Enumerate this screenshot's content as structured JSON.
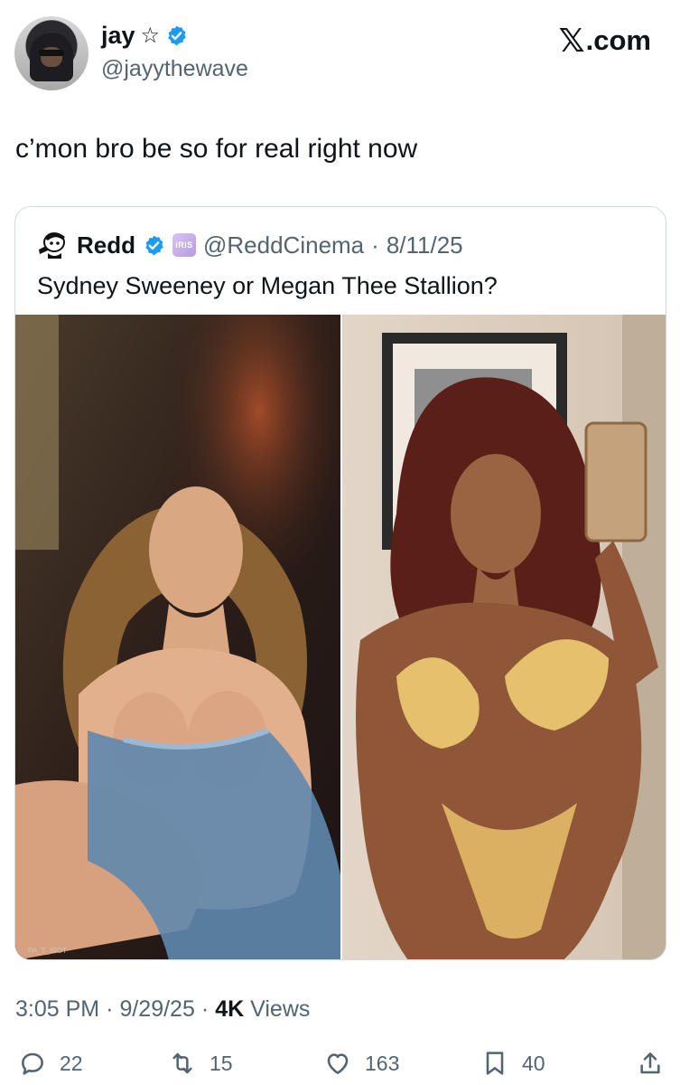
{
  "author": {
    "display_name": "jay",
    "star_glyph": "☆",
    "handle": "@jayythewave"
  },
  "brand": {
    "logo_text": ".com",
    "logo_mark": "𝕏"
  },
  "tweet": {
    "text": "c’mon bro be so for real right now"
  },
  "quoted": {
    "display_name": "Redd",
    "badge_text": "iRIS",
    "handle": "@ReddCinema",
    "separator": "·",
    "date": "8/11/25",
    "text": "Sydney Sweeney or Megan Thee Stallion?",
    "watermark": "PA_T_IROT"
  },
  "meta": {
    "time": "3:05 PM",
    "sep1": "·",
    "date": "9/29/25",
    "sep2": "·",
    "views_count": "4K",
    "views_label": "Views"
  },
  "actions": {
    "replies": "22",
    "reposts": "15",
    "likes": "163",
    "bookmarks": "40"
  },
  "colors": {
    "verified_blue": "#1d9bf0",
    "secondary_text": "#536471",
    "primary_text": "#0f1419",
    "border": "#cfd9de"
  }
}
